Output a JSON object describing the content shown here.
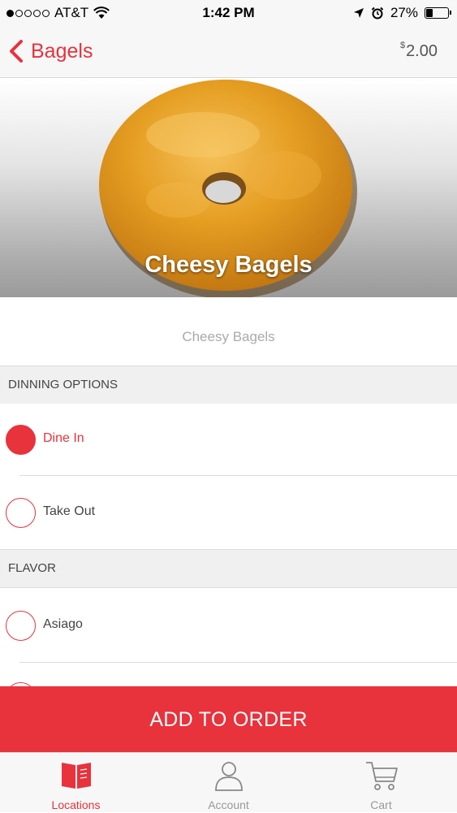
{
  "status": {
    "carrier": "AT&T",
    "time": "1:42 PM",
    "battery": "27%",
    "battery_level": 0.27,
    "signal_bars_filled": 1,
    "signal_bars_total": 5
  },
  "nav": {
    "back_label": "Bagels",
    "price_symbol": "$",
    "price_value": "2.00"
  },
  "hero": {
    "title": "Cheesy Bagels"
  },
  "item": {
    "description": "Cheesy Bagels"
  },
  "sections": {
    "dining": {
      "header": "DINNING OPTIONS",
      "options": [
        {
          "label": "Dine In",
          "selected": true
        },
        {
          "label": "Take Out",
          "selected": false
        }
      ]
    },
    "flavor": {
      "header": "FLAVOR",
      "options": [
        {
          "label": "Asiago",
          "selected": false
        }
      ]
    }
  },
  "add_button": {
    "label": "ADD TO ORDER"
  },
  "tabs": [
    {
      "label": "Locations",
      "icon": "book-icon",
      "active": true
    },
    {
      "label": "Account",
      "icon": "person-icon",
      "active": false
    },
    {
      "label": "Cart",
      "icon": "cart-icon",
      "active": false
    }
  ],
  "colors": {
    "accent": "#e8323c",
    "background": "#f7f7f7"
  }
}
